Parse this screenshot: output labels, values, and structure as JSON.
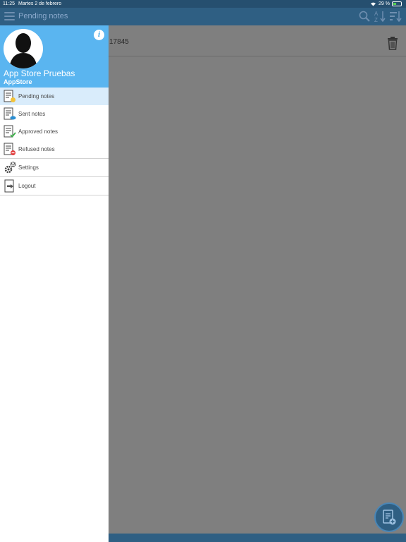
{
  "status_bar": {
    "time": "11:25",
    "date": "Martes 2 de febrero",
    "battery": "29 %"
  },
  "app_bar": {
    "title": "Pending notes"
  },
  "content": {
    "rows": [
      {
        "number": "17845"
      }
    ]
  },
  "drawer": {
    "user": {
      "name": "App Store Pruebas",
      "organization": "AppStore"
    },
    "info_glyph": "i",
    "menu": [
      {
        "label": "Pending notes",
        "icon": "pending-notes-icon",
        "active": true
      },
      {
        "label": "Sent notes",
        "icon": "sent-notes-icon"
      },
      {
        "label": "Approved notes",
        "icon": "approved-notes-icon"
      },
      {
        "label": "Refused notes",
        "icon": "refused-notes-icon"
      },
      {
        "label": "Settings",
        "icon": "gear-icon"
      },
      {
        "label": "Logout",
        "icon": "logout-icon"
      }
    ]
  },
  "colors": {
    "app_bar": "#2f5f83",
    "drawer_header": "#5ab5f0",
    "active_item": "#d9ecfb",
    "overlay": "#7f7f7f"
  }
}
